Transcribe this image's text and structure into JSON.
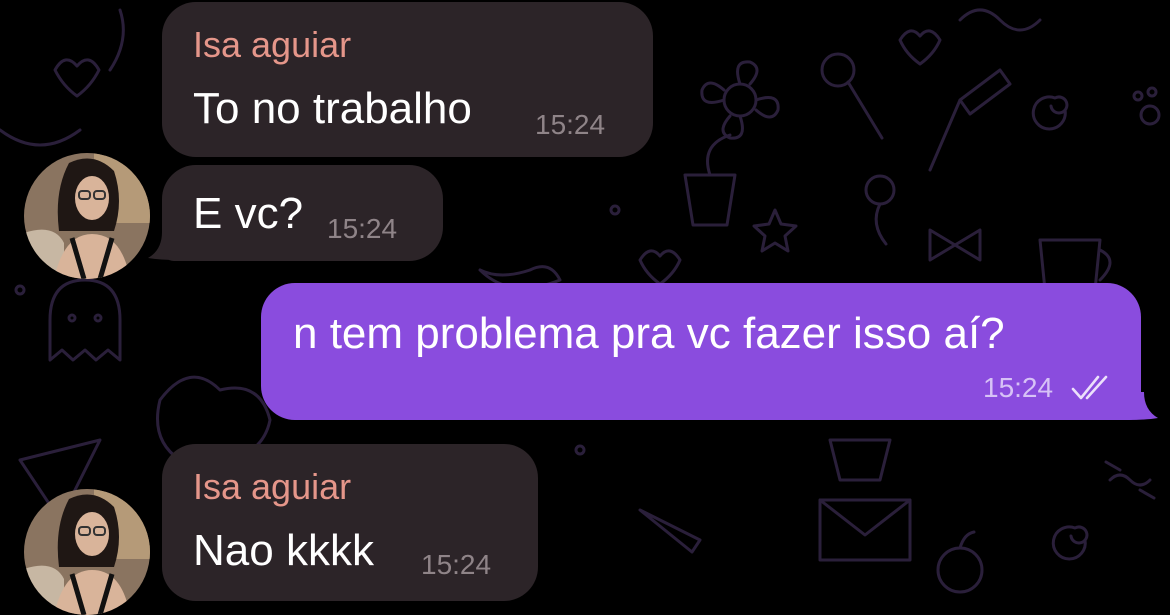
{
  "theme": {
    "background": "#000000",
    "incoming_bubble": "#2c2428",
    "outgoing_bubble": "#8a4cde",
    "sender_name_color": "#e5968a",
    "doodle_color": "#2a1f3a"
  },
  "messages": [
    {
      "direction": "incoming",
      "sender": "Isa aguiar",
      "text": "To no trabalho",
      "time": "15:24"
    },
    {
      "direction": "incoming",
      "sender": "",
      "text": "E vc?",
      "time": "15:24",
      "avatar": "contact-avatar"
    },
    {
      "direction": "outgoing",
      "text": "n tem problema pra vc fazer isso aí?",
      "time": "15:24",
      "status_icon": "double-check-icon"
    },
    {
      "direction": "incoming",
      "sender": "Isa aguiar",
      "text": "Nao kkkk",
      "time": "15:24",
      "avatar": "contact-avatar"
    }
  ]
}
